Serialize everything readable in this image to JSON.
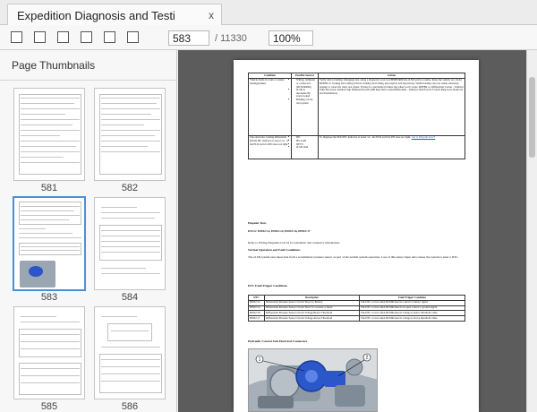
{
  "tab": {
    "title": "Expedition Diagnosis and Testi",
    "close": "x"
  },
  "toolbar": {
    "page_value": "583",
    "page_total": "/ 11330",
    "zoom_value": "100%"
  },
  "sidebar": {
    "title": "Page Thumbnails",
    "thumbnails": [
      {
        "label": "581"
      },
      {
        "label": "582"
      },
      {
        "label": "583",
        "selected": true
      },
      {
        "label": "584"
      },
      {
        "label": "585"
      },
      {
        "label": "586"
      }
    ]
  },
  "doc": {
    "table1": {
      "headers": [
        "Condition",
        "Possible Sources",
        "Actions"
      ],
      "rows": [
        {
          "condition": "Vehicle binds in a turn or resists turning/judders",
          "sources": [
            "Wiring, terminals or connectors (DCM/RDM)",
            "eLSD is mechanically stuck locked",
            "Binding a front 4x4 system"
          ],
          "action": "Verify unit is binding; disengage test, using a diagnostic scan tool PERFORM the eLSD service routine. Raise the vehicle on a hoist. REFER to: Jacking and Lifting (100-02 Jacking and Lifting, Description and Operation). While holding one rear wheel stationary, attempt to rotate the other rear wheel. If there is a mechanical failure the wheel won't rotate. REFER to: Differential Carrier - Vehicles With Electronic Limited-Slip Differential (205-02B Rear Drive Axle/Differential - Vehicles With Ford 9.75 Inch Ring Gear, Removal and Installation)."
        },
        {
          "condition": "The electronic locking differential (ELD) IPC indicator is never on - or the ELD switch LED does not light",
          "sources": [
            "IPC",
            "HS-CAN",
            "NEVS",
            "eLSD fault"
          ],
          "action": "To diagnose the ELD IPC indicator is never on - the ELD switch LED does not light,",
          "link": "GO to Pinpoint Test F"
        }
      ]
    },
    "pinpoint_title": "Pinpoint Tests",
    "dtc_list": "DTCS: P0932:12, P0932:14, P0932:16, P0932:17",
    "refer_text": "Refer to Wiring Diagrams Cell 34 for schematic and connector information.",
    "normal_heading": "Normal Operation and Fault Conditions",
    "normal_text": "The eLSD system uses input data from a accumulator pressure sensor as part of the normal system operation. Loss of this sensor input data causes the system to enter a DTC.",
    "dtc_trigger_heading": "DTC Fault Trigger Conditions",
    "table2": {
      "headers": [
        "DTC",
        "Description",
        "Fault Trigger Condition"
      ],
      "rows": [
        [
          "P0932:12",
          "Differential Pressure Sensor Circuit Short To Battery",
          "The DTC occurs when DCMR detects a short to battery signal."
        ],
        [
          "P0932:14",
          "Differential Pressure Sensor Circuit Short To Ground or Open",
          "The DTC occurs when DCMR detects an open a short to ground signal."
        ],
        [
          "P0932:16",
          "Differential Pressure Sensor Circuit Voltage Below Threshold",
          "The DTC occurs when DCMR detects voltage is below threshold value."
        ],
        [
          "P0932:17",
          "Differential Pressure Sensor Circuit Voltage Above Threshold",
          "The DTC occurs when DCMR detects voltage is above threshold value."
        ]
      ]
    },
    "hydraulic_heading": "Hydraulic Control Unit Electrical Connectors",
    "callout_1": "1",
    "callout_2": "2"
  }
}
